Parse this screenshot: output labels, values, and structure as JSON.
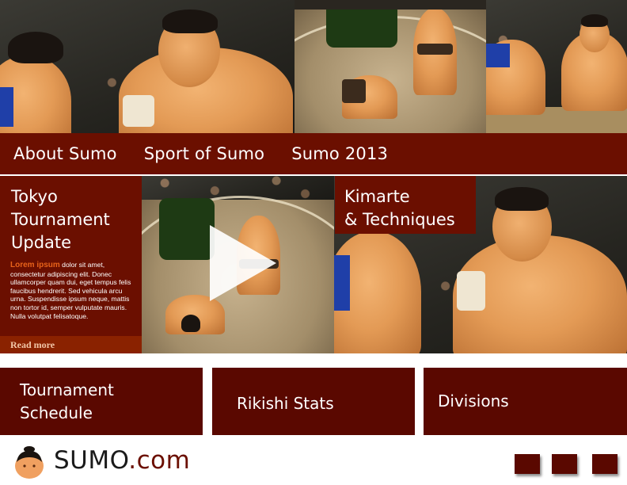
{
  "nav": {
    "items": [
      {
        "label": "About Sumo"
      },
      {
        "label": "Sport of Sumo"
      },
      {
        "label": "Sumo 2013"
      }
    ]
  },
  "feature": {
    "title_lines": [
      "Tokyo",
      "Tournament",
      "Update"
    ],
    "lead": "Lorem ipsum",
    "body": " dolor sit amet, consectetur adipiscing elit. Donec ullamcorper quam dui, eget tempus felis faucibus hendrerit. Sed vehicula arcu urna. Suspendisse ipsum neque, mattis non tortor id, semper vulputate mauris. Nulla volutpat felisatoque.",
    "read_more": "Read more"
  },
  "kimarte": {
    "title_lines": [
      "Kimarte",
      "& Techniques"
    ]
  },
  "tiles": [
    {
      "lines": [
        "Tournament",
        "Schedule"
      ]
    },
    {
      "lines": [
        "Rikishi Stats"
      ]
    },
    {
      "lines": [
        "Divisions"
      ]
    }
  ],
  "footer": {
    "logo_main": "SUMO",
    "logo_suffix": ".com"
  },
  "colors": {
    "primary": "#6b0f00",
    "tile": "#5a0800",
    "accent": "#e8631a"
  },
  "icons": {
    "play": "play-icon",
    "mascot": "sumo-mascot-icon"
  }
}
